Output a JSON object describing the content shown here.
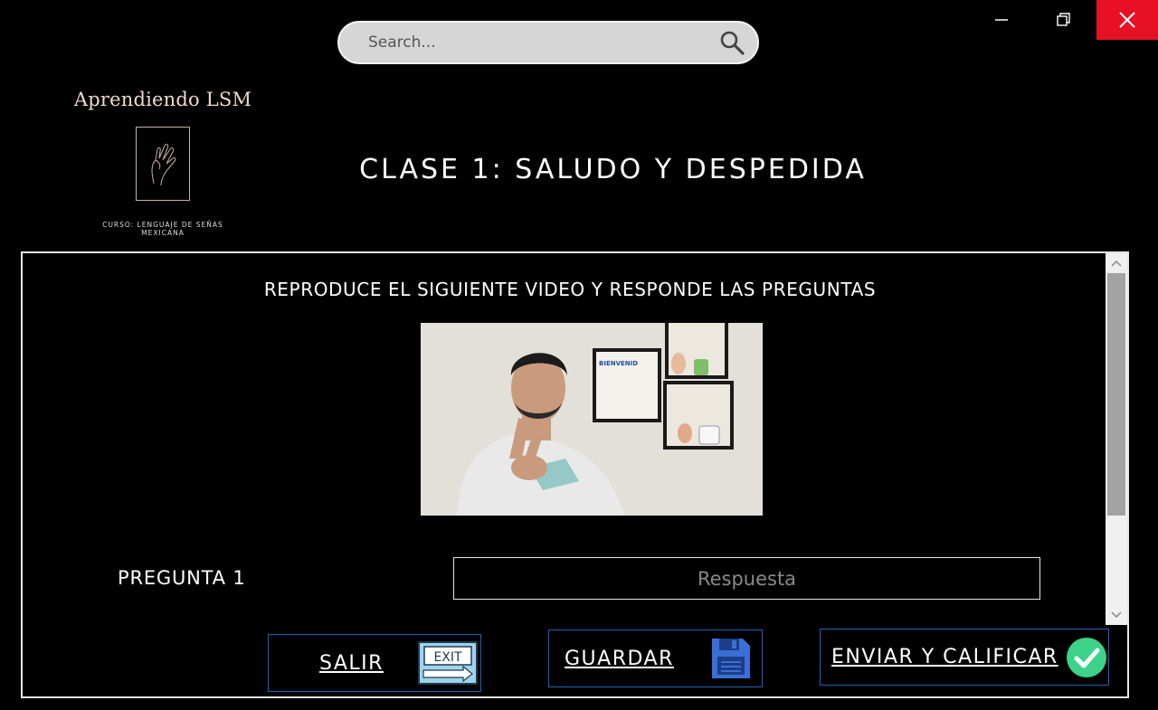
{
  "window": {
    "minimize_label": "minimize",
    "restore_label": "restore",
    "close_label": "close"
  },
  "search": {
    "placeholder": "Search..."
  },
  "brand": {
    "name": "Aprendiendo LSM",
    "subtitle_line1": "CURSO: LENGUAJE DE SEÑAS",
    "subtitle_line2": "MEXICANA"
  },
  "page": {
    "title": "CLASE 1: SALUDO Y DESPEDIDA",
    "instructions": "REPRODUCE EL SIGUIENTE VIDEO Y RESPONDE LAS PREGUNTAS"
  },
  "video": {
    "sign_text": "BIENVENID"
  },
  "question": {
    "label": "PREGUNTA 1",
    "answer_placeholder": "Respuesta",
    "answer_value": ""
  },
  "actions": {
    "exit_label": "SALIR",
    "exit_icon_text": "EXIT",
    "save_label": "GUARDAR",
    "submit_label": "ENVIAR Y CALIFICAR"
  },
  "colors": {
    "close_red": "#e81123",
    "button_border": "#1e63b5",
    "save_icon": "#3a6fd8",
    "check_green": "#3dd28a",
    "exit_icon_bg": "#9fd3e8"
  },
  "icons": [
    "minimize-icon",
    "restore-icon",
    "close-icon",
    "search-icon",
    "hand-logo-icon",
    "exit-sign-icon",
    "floppy-disk-icon",
    "check-circle-icon"
  ]
}
